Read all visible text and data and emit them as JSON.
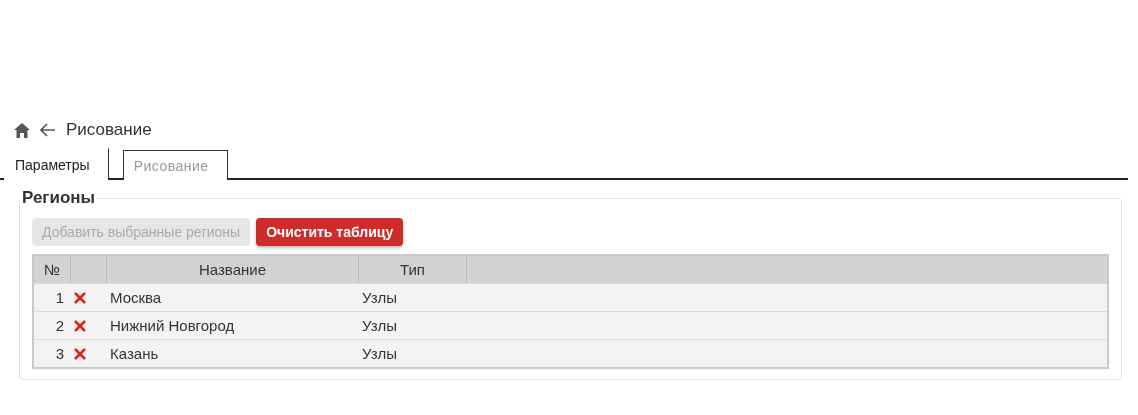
{
  "header": {
    "title": "Рисование"
  },
  "tabs": [
    {
      "label": "Параметры",
      "selected": true
    },
    {
      "label": "Рисование",
      "selected": false
    }
  ],
  "section": {
    "title": "Регионы"
  },
  "buttons": [
    {
      "label": "Добавить выбранные регионы",
      "disabled": true
    },
    {
      "label": "Очистить таблицу",
      "disabled": false
    }
  ],
  "table": {
    "columns": [
      "№",
      "Название",
      "Тип"
    ],
    "rows": [
      {
        "number": "1",
        "name": "Москва",
        "type": "Узлы"
      },
      {
        "number": "2",
        "name": "Нижний Новгород",
        "type": "Узлы"
      },
      {
        "number": "3",
        "name": "Казань",
        "type": "Узлы"
      }
    ]
  }
}
